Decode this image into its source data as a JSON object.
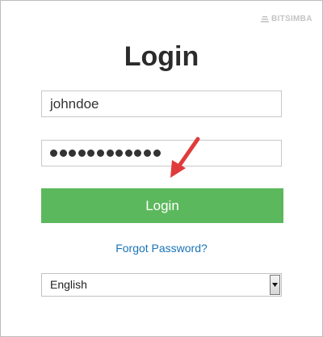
{
  "brand": {
    "name": "BITSIMBA",
    "icon": "stacked-bars-logo-icon"
  },
  "page": {
    "title": "Login"
  },
  "form": {
    "username_value": "johndoe",
    "password_masked": "●●●●●●●●●●●●",
    "password_length": 12,
    "login_button_label": "Login",
    "forgot_password_label": "Forgot Password?"
  },
  "language": {
    "selected": "English",
    "dropdown_icon": "triangle-down-icon"
  },
  "annotation": {
    "icon": "red-arrow-icon",
    "color": "#e03b3b"
  },
  "colors": {
    "login_button": "#5cb85c",
    "link": "#1a74b8",
    "title": "#2b2b2b"
  }
}
